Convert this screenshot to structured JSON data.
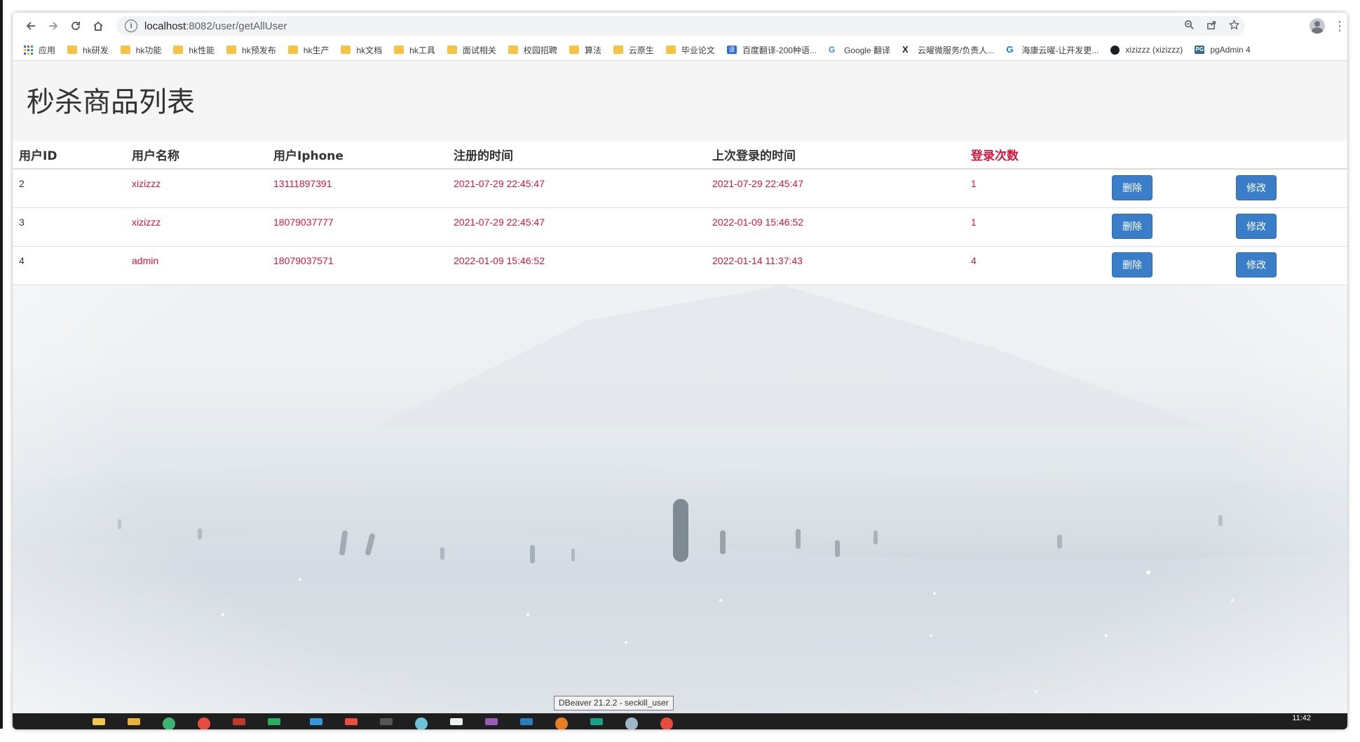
{
  "browser": {
    "url_host": "localhost",
    "url_path": ":8082/user/getAllUser",
    "nav_icons": {
      "back": "arrow-left-icon",
      "forward": "arrow-right-icon",
      "reload": "reload-icon",
      "home": "home-icon"
    },
    "bookmarks": [
      {
        "label": "应用",
        "icon": "apps-icon"
      },
      {
        "label": "hk研发",
        "icon": "folder-icon"
      },
      {
        "label": "hk功能",
        "icon": "folder-icon"
      },
      {
        "label": "hk性能",
        "icon": "folder-icon"
      },
      {
        "label": "hk预发布",
        "icon": "folder-icon"
      },
      {
        "label": "hk生产",
        "icon": "folder-icon"
      },
      {
        "label": "hk文档",
        "icon": "folder-icon"
      },
      {
        "label": "hk工具",
        "icon": "folder-icon"
      },
      {
        "label": "面试相关",
        "icon": "folder-icon"
      },
      {
        "label": "校园招聘",
        "icon": "folder-icon"
      },
      {
        "label": "算法",
        "icon": "folder-icon"
      },
      {
        "label": "云原生",
        "icon": "folder-icon"
      },
      {
        "label": "毕业论文",
        "icon": "folder-icon"
      },
      {
        "label": "百度翻译-200种语...",
        "icon": "translate-icon",
        "glyph": "译"
      },
      {
        "label": "Google 翻译",
        "icon": "google-translate-icon",
        "glyph": "G"
      },
      {
        "label": "云曜微服务/负责人...",
        "icon": "x-logo-icon",
        "glyph": "X"
      },
      {
        "label": "海康云曜-让开发更...",
        "icon": "hik-logo-icon",
        "glyph": "G"
      },
      {
        "label": "xizizzz (xizizzz)",
        "icon": "github-icon"
      },
      {
        "label": "pgAdmin 4",
        "icon": "pgadmin-icon",
        "glyph": "PG"
      }
    ],
    "more_glyph": "»"
  },
  "page": {
    "title": "秒杀商品列表",
    "table": {
      "headers": [
        "用户ID",
        "用户名称",
        "用户Iphone",
        "注册的时间",
        "上次登录的时间",
        "登录次数"
      ],
      "rows": [
        {
          "id": "2",
          "name": "xizizzz",
          "phone": "13111897391",
          "register_time": "2021-07-29 22:45:47",
          "last_login": "2021-07-29 22:45:47",
          "login_count": "1"
        },
        {
          "id": "3",
          "name": "xizizzz",
          "phone": "18079037777",
          "register_time": "2021-07-29 22:45:47",
          "last_login": "2022-01-09 15:46:52",
          "login_count": "1"
        },
        {
          "id": "4",
          "name": "admin",
          "phone": "18079037571",
          "register_time": "2022-01-09 15:46:52",
          "last_login": "2022-01-14 11:37:43",
          "login_count": "4"
        }
      ],
      "delete_label": "删除",
      "edit_label": "修改"
    }
  },
  "taskbar": {
    "tooltip": "DBeaver 21.2.2 - seckill_user",
    "clock": "11:42"
  },
  "colors": {
    "accent_red": "#dc143c",
    "button_blue": "#3a7dc9",
    "folder_yellow": "#f6c344"
  }
}
